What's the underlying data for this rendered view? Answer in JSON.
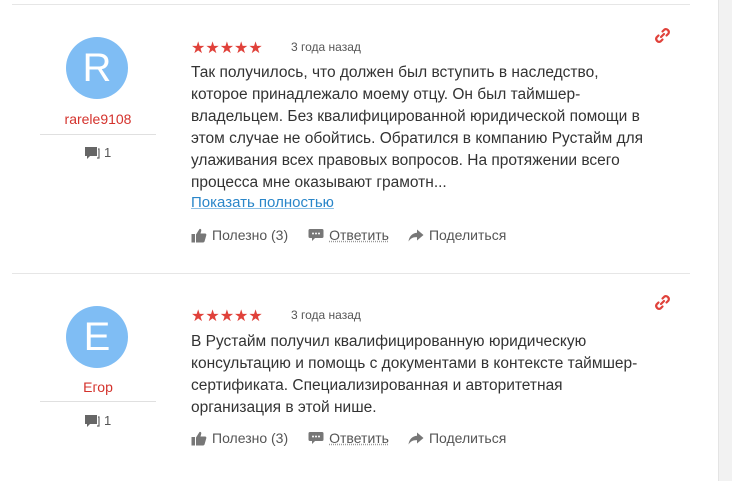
{
  "colors": {
    "accent_red": "#d4322c",
    "star_red": "#e0413a",
    "link_blue": "#2a86c9",
    "avatar_blue": "#7fbdf4"
  },
  "reviews": [
    {
      "initial": "R",
      "username": "rarele9108",
      "user_review_count": "1",
      "rating": 5,
      "stars": "★★★★★",
      "date": "3 года назад",
      "lines": [
        "Так получилось, что должен был вступить в наследство,",
        "которое принадлежало моему отцу. Он был таймшер-",
        "владельцем. Без квалифицированной юридической помощи в",
        "этом случае не обойтись. Обратился в компанию Рустайм для",
        "улаживания всех правовых вопросов. На протяжении всего",
        "процесса мне оказывают грамотн..."
      ],
      "show_more": "Показать полностью",
      "useful": "Полезно (3)",
      "reply": "Ответить",
      "share": "Поделиться"
    },
    {
      "initial": "Е",
      "username": "Егор",
      "user_review_count": "1",
      "rating": 5,
      "stars": "★★★★★",
      "date": "3 года назад",
      "lines": [
        "В Рустайм получил квалифицированную юридическую",
        "консультацию и помощь с документами в контексте таймшер-",
        "сертификата. Специализированная и авторитетная",
        "организация в этой нише."
      ],
      "useful": "Полезно (3)",
      "reply": "Ответить",
      "share": "Поделиться"
    }
  ]
}
